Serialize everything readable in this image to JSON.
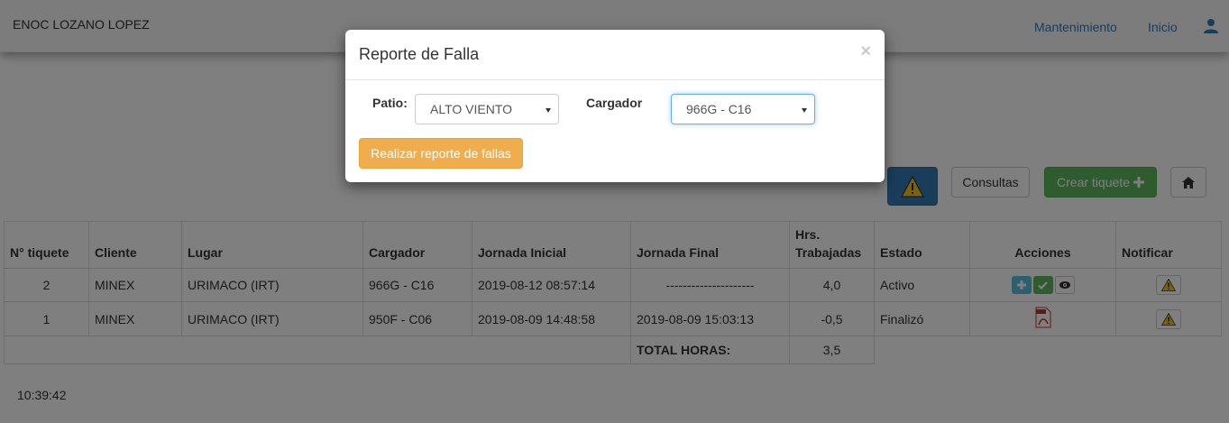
{
  "navbar": {
    "user_name": "ENOC LOZANO LOPEZ",
    "links": [
      "Mantenimiento",
      "Inicio"
    ],
    "user_icon": "user-icon"
  },
  "toolbar": {
    "warning_icon": "warning-icon",
    "consultas_label": "Consultas",
    "crear_label": "Crear tiquete",
    "home_icon": "home-icon"
  },
  "table": {
    "headers": [
      "N° tiquete",
      "Cliente",
      "Lugar",
      "Cargador",
      "Jornada Inicial",
      "Jornada Final",
      "Hrs. Trabajadas",
      "Estado",
      "Acciones",
      "Notificar"
    ],
    "rows": [
      [
        "2",
        "MINEX",
        "URIMACO (IRT)",
        "966G - C16",
        "2019-08-12 08:57:14",
        "---------------------",
        "4,0",
        "Activo"
      ],
      [
        "1",
        "MINEX",
        "URIMACO (IRT)",
        "950F - C06",
        "2019-08-09 14:48:58",
        "2019-08-09 15:03:13",
        "-0,5",
        "Finalizó"
      ]
    ],
    "total_label": "TOTAL HORAS:",
    "total_value": "3,5"
  },
  "clock": "10:39:42",
  "modal": {
    "title": "Reporte de Falla",
    "close": "×",
    "patio_label": "Patio:",
    "patio_value": "ALTO VIENTO",
    "cargador_label": "Cargador",
    "cargador_value": "966G - C16",
    "submit_label": "Realizar reporte de fallas"
  },
  "colors": {
    "primary": "#337ab7",
    "success": "#5cb85c",
    "warning": "#f0ad4e",
    "info": "#5bc0de"
  }
}
